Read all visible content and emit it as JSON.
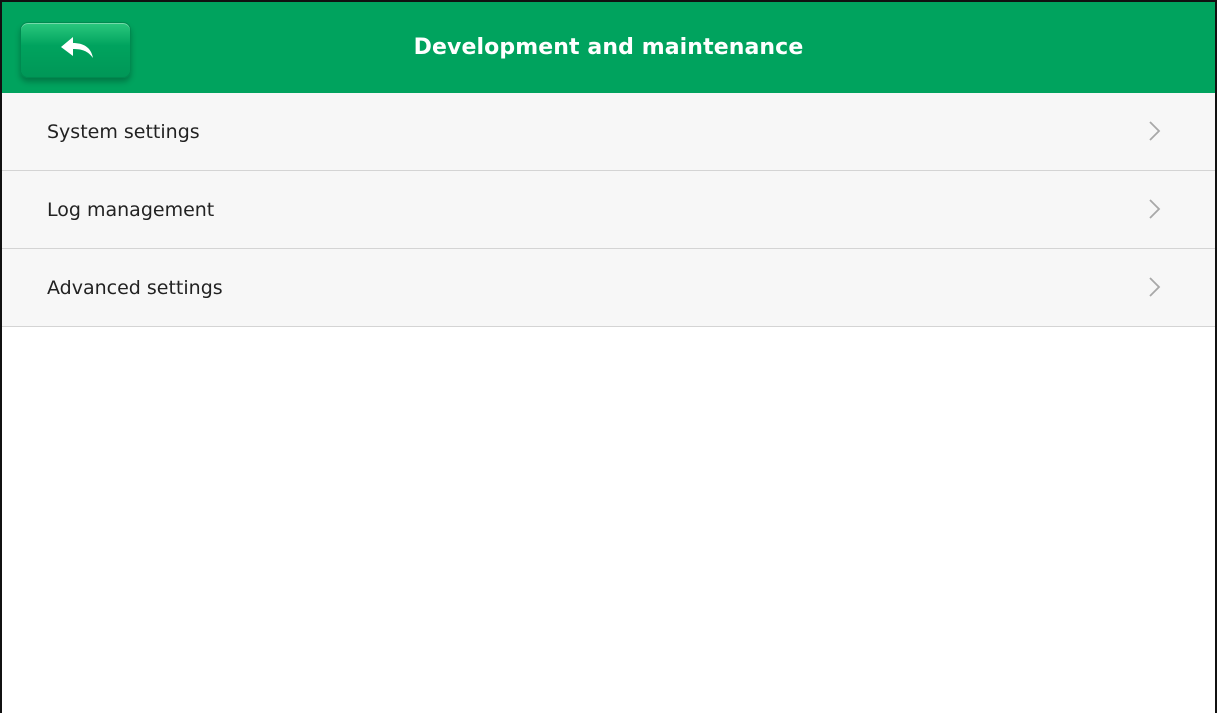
{
  "header": {
    "title": "Development and maintenance",
    "back_icon": "back-arrow-icon",
    "color": "#00a35e"
  },
  "menu": {
    "items": [
      {
        "label": "System settings",
        "icon": "chevron-right-icon"
      },
      {
        "label": "Log management",
        "icon": "chevron-right-icon"
      },
      {
        "label": "Advanced settings",
        "icon": "chevron-right-icon"
      }
    ]
  }
}
